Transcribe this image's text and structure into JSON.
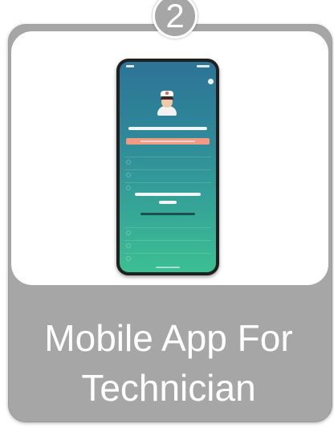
{
  "badge": {
    "number": "2"
  },
  "card": {
    "title_line1": "Mobile App For",
    "title_line2": "Technician"
  },
  "phone_mockup": {
    "avatar_icon": "doctor-avatar-icon",
    "close_icon": "close-icon"
  },
  "colors": {
    "card_gray": "#a6a6a6",
    "panel": "#ffffff",
    "title_text": "#ffffff",
    "screen_top": "#2d7397",
    "screen_bottom": "#3cbf93",
    "accent_bar": "#f39a84"
  }
}
